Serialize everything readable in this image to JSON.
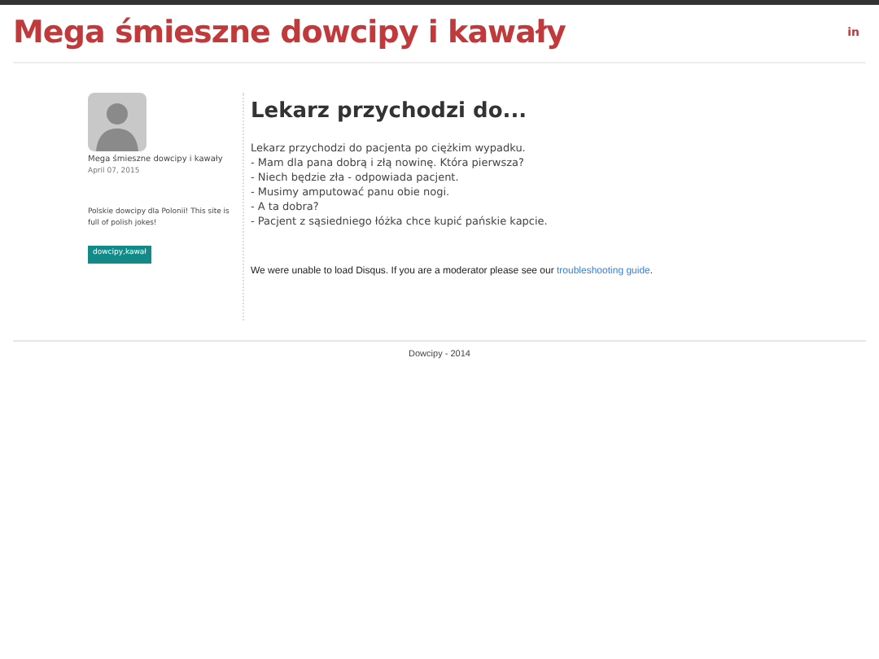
{
  "header": {
    "title": "Mega śmieszne dowcipy i kawały",
    "social": "in"
  },
  "sidebar": {
    "author": "Mega śmieszne dowcipy i kawały",
    "date": "April 07, 2015",
    "description": "Polskie dowcipy dla Polonii! This site is full of polish jokes!",
    "tag": "dowcipy,kawał"
  },
  "post": {
    "title": "Lekarz przychodzi do...",
    "lines": [
      "Lekarz przychodzi do pacjenta po ciężkim wypadku.",
      "- Mam dla pana dobrą i złą nowinę. Która pierwsza?",
      "- Niech będzie zła - odpowiada pacjent.",
      "- Musimy amputować panu obie nogi.",
      "- A ta dobra?",
      "- Pacjent z sąsiedniego łóżka chce kupić pańskie kapcie."
    ]
  },
  "comments": {
    "message": "We were unable to load Disqus. If you are a moderator please see our",
    "link": "troubleshooting guide",
    "end": "."
  },
  "footer": "Dowcipy - 2014"
}
